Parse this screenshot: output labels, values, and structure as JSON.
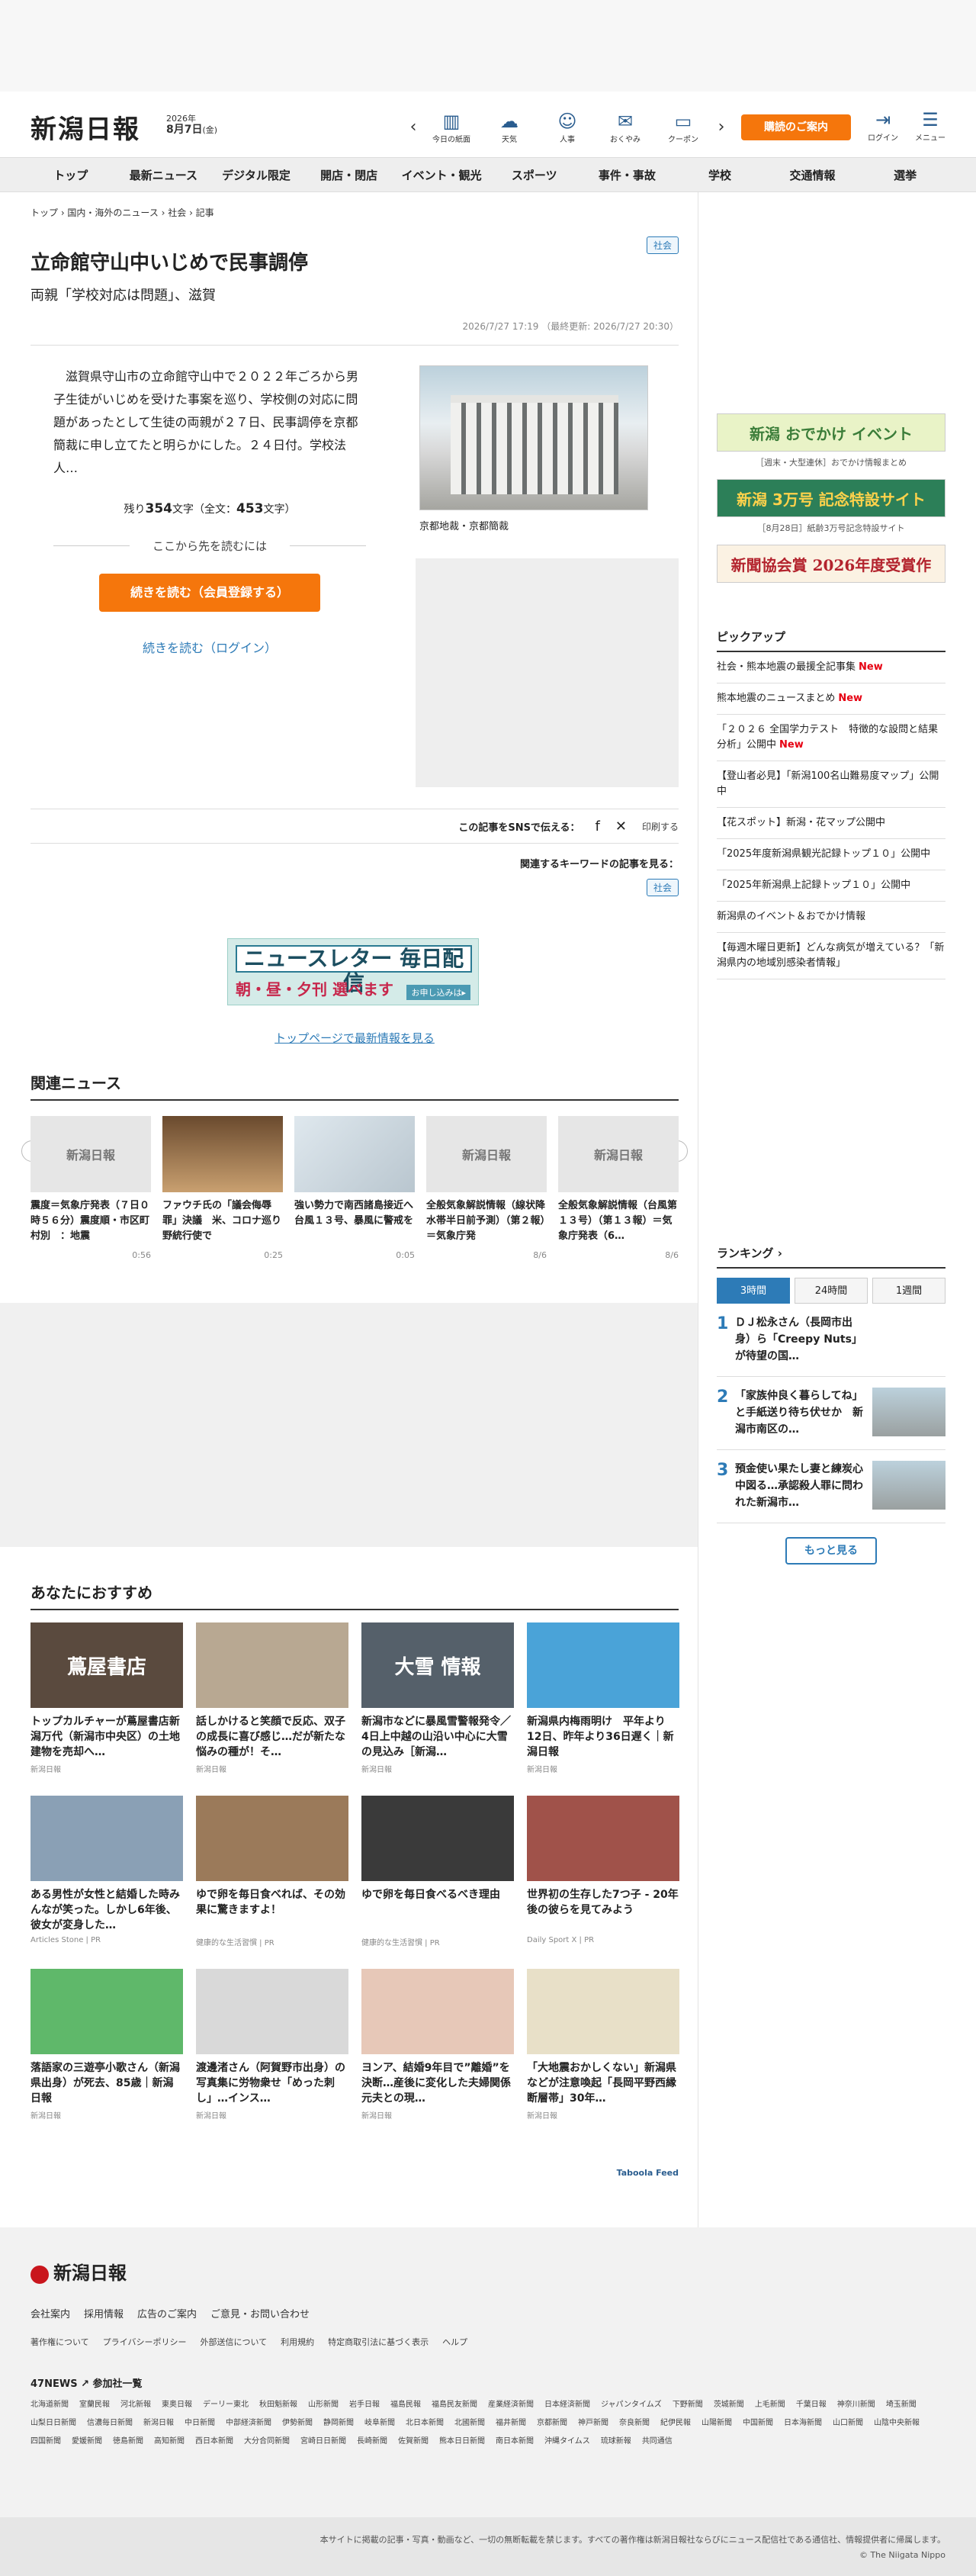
{
  "header": {
    "logo": "新潟日報",
    "date_year": "2026年",
    "date_md": "8月7日",
    "date_wd": "(金)",
    "icons": [
      {
        "label": "今日の紙面",
        "icon": "newspaper-icon",
        "glyph": "▥"
      },
      {
        "label": "天気",
        "icon": "weather-icon",
        "glyph": "☁"
      },
      {
        "label": "人事",
        "icon": "people-icon",
        "glyph": "☺"
      },
      {
        "label": "おくやみ",
        "icon": "condolence-icon",
        "glyph": "✉"
      },
      {
        "label": "クーポン",
        "icon": "coupon-icon",
        "glyph": "▭"
      }
    ],
    "subscribe": "購読のご案内",
    "login": "ログイン",
    "menu": "メニュー"
  },
  "nav": [
    "トップ",
    "最新ニュース",
    "デジタル限定",
    "開店・閉店",
    "イベント・観光",
    "スポーツ",
    "事件・事故",
    "学校",
    "交通情報",
    "選挙"
  ],
  "article": {
    "breadcrumb": "トップ › 国内・海外のニュース › 社会 › 記事",
    "tag": "社会",
    "title": "立命館守山中いじめで民事調停",
    "subtitle": "両親「学校対応は問題」、滋賀",
    "datetime": "2026/7/27 17:19 （最終更新: 2026/7/27 20:30）",
    "lead": "滋賀県守山市の立命館守山中で２０２２年ごろから男子生徒がいじめを受けた事案を巡り、学校側の対応に問題があったとして生徒の両親が２７日、民事調停を京都簡裁に申し立てたと明らかにした。２４日付。学校法人…",
    "remaining_pre": "残り",
    "remaining_num": "354",
    "remaining_mid": "文字（全文：",
    "total_num": "453",
    "remaining_post": "文字）",
    "continue_text": "ここから先を読むには",
    "register_btn": "続きを読む（会員登録する）",
    "login_link": "続きを読む（ログイン）",
    "photo_caption": "京都地裁・京都簡裁",
    "share_label": "この記事をSNSで伝える：",
    "print": "印刷する",
    "keyword_label": "関連するキーワードの記事を見る：",
    "keyword_tag": "社会",
    "newsletter_title": "ニュースレター 毎日配信",
    "newsletter_sub": "朝・昼・夕刊 選べます",
    "newsletter_btn": "お申し込みは▸",
    "top_link": "トップページで最新情報を見る"
  },
  "related": {
    "heading": "関連ニュース",
    "items": [
      {
        "text": "震度＝気象庁発表（７日０時５６分）震度順・市区町村別　：地震",
        "time": "0:56",
        "thumb": "新潟日報"
      },
      {
        "text": "ファウチ氏の「議会侮辱罪」決議　米、コロナ巡り野統行使で",
        "time": "0:25",
        "thumb": ""
      },
      {
        "text": "強い勢力で南西諸島接近へ　台風１３号、暴風に警戒を",
        "time": "0:05",
        "thumb": ""
      },
      {
        "text": "全般気象解説情報（線状降水帯半日前予測）（第２報）＝気象庁発",
        "time": "8/6",
        "thumb": "新潟日報"
      },
      {
        "text": "全般気象解説情報（台風第１３号）（第１３報）＝気象庁発表（6…",
        "time": "8/6",
        "thumb": "新潟日報"
      }
    ]
  },
  "recommend": {
    "heading": "あなたにおすすめ",
    "taboola": "Taboola Feed",
    "items": [
      {
        "text": "トップカルチャーが蔦屋書店新潟万代（新潟市中央区）の土地建物を売却へ…",
        "src": "新潟日報",
        "thumb": "蔦屋書店",
        "color": "#5a4a3e"
      },
      {
        "text": "話しかけると笑顔で反応、双子の成長に喜び感じ…だが新たな悩みの種が！そ…",
        "src": "新潟日報",
        "thumb": "",
        "color": "#b8a892"
      },
      {
        "text": "新潟市などに暴風雪警報発令／4日上中越の山沿い中心に大雪の見込み［新潟…",
        "src": "新潟日報",
        "thumb": "大雪 情報",
        "color": "#55606a"
      },
      {
        "text": "新潟県内梅雨明け　平年より12日、昨年より36日遅く｜新潟日報",
        "src": "新潟日報",
        "thumb": "",
        "color": "#4aa3d8"
      },
      {
        "text": "ある男性が女性と結婚した時みんなが笑った。しかし6年後、彼女が変身した…",
        "src": "Articles Stone | PR",
        "thumb": "",
        "color": "#8aa0b5"
      },
      {
        "text": "ゆで卵を毎日食べれば、その効果に驚きますよ！",
        "src": "健康的な生活習慣 | PR",
        "thumb": "",
        "color": "#9b7a5a"
      },
      {
        "text": "ゆで卵を毎日食べるべき理由",
        "src": "健康的な生活習慣 | PR",
        "thumb": "",
        "color": "#3a3a3a"
      },
      {
        "text": "世界初の生存した7つ子 - 20年後の彼らを見てみよう",
        "src": "Daily Sport X | PR",
        "thumb": "",
        "color": "#a0524a"
      },
      {
        "text": "落語家の三遊亭小歌さん（新潟県出身）が死去、85歳｜新潟日報",
        "src": "新潟日報",
        "thumb": "",
        "color": "#5fb86a"
      },
      {
        "text": "渡邊渚さん（阿賀野市出身）の写真集に労物衆せ「めった刺し」…インス…",
        "src": "新潟日報",
        "thumb": "",
        "color": "#d9d9d9"
      },
      {
        "text": "ヨンア、結婚9年目で”離婚”を決断…産後に変化した夫婦関係　元夫との現…",
        "src": "新潟日報",
        "thumb": "",
        "color": "#e7c8b8"
      },
      {
        "text": "「大地震おかしくない」新潟県などが注意喚起「長岡平野西縁断層帯」30年…",
        "src": "新潟日報",
        "thumb": "",
        "color": "#e8e0c8"
      }
    ]
  },
  "side": {
    "banners": [
      {
        "text": "新潟 おでかけ イベント",
        "caption": "［週末・大型連休］おでかけ情報まとめ"
      },
      {
        "text": "新潟 3万号 記念特設サイト",
        "caption": "［8月28日］紙齢3万号記念特設サイト"
      },
      {
        "text": "新聞協会賞 2026年度受賞作",
        "caption": ""
      }
    ],
    "pickup_heading": "ピックアップ",
    "pickup": [
      {
        "text": "社会・熊本地震の最援全記事集",
        "new": "New"
      },
      {
        "text": "熊本地震のニュースまとめ",
        "new": "New"
      },
      {
        "text": "「２０２６ 全国学力テスト　特徴的な設問と結果分析」公開中",
        "new": "New"
      },
      {
        "text": "【登山者必見】「新潟100名山難易度マップ」公開中",
        "new": ""
      },
      {
        "text": "【花スポット】新潟・花マップ公開中",
        "new": ""
      },
      {
        "text": "「2025年度新潟県観光記録トップ１０」公開中",
        "new": ""
      },
      {
        "text": "「2025年新潟県上記録トップ１０」公開中",
        "new": ""
      },
      {
        "text": "新潟県のイベント＆おでかけ情報",
        "new": ""
      },
      {
        "text": "【毎週木曜日更新】どんな病気が増えている？「新潟県内の地域別感染者情報」",
        "new": ""
      }
    ],
    "ranking_heading": "ランキング ›",
    "ranking_tabs": [
      "3時間",
      "24時間",
      "1週間"
    ],
    "ranking": [
      {
        "num": "1",
        "text": "ＤＪ松永さん（長岡市出身）ら「Creepy Nuts」が待望の国…"
      },
      {
        "num": "2",
        "text": "「家族仲良く暮らしてね」と手紙送り待ち伏せか　新潟市南区の…"
      },
      {
        "num": "3",
        "text": "預金使い果たし妻と練炭心中図る…承認殺人罪に問われた新潟市…"
      }
    ],
    "more": "もっと見る"
  },
  "footer": {
    "logo": "新潟日報",
    "row1": [
      "会社案内",
      "採用情報",
      "広告のご案内",
      "ご意見・お問い合わせ"
    ],
    "row2": [
      "著作権について",
      "プライバシーポリシー",
      "外部送信について",
      "利用規約",
      "特定商取引法に基づく表示",
      "ヘルプ"
    ],
    "news47": "47NEWS ↗ 参加社一覧",
    "papers": [
      "北海道新聞",
      "室蘭民報",
      "河北新報",
      "東奥日報",
      "デーリー東北",
      "秋田魁新報",
      "山形新聞",
      "岩手日報",
      "福島民報",
      "福島民友新聞",
      "産業経済新聞",
      "日本経済新聞",
      "ジャパンタイムズ",
      "下野新聞",
      "茨城新聞",
      "上毛新聞",
      "千葉日報",
      "神奈川新聞",
      "埼玉新聞",
      "山梨日日新聞",
      "信濃毎日新聞",
      "新潟日報",
      "中日新聞",
      "中部経済新聞",
      "伊勢新聞",
      "静岡新聞",
      "岐阜新聞",
      "北日本新聞",
      "北國新聞",
      "福井新聞",
      "京都新聞",
      "神戸新聞",
      "奈良新聞",
      "紀伊民報",
      "山陽新聞",
      "中国新聞",
      "日本海新聞",
      "山口新聞",
      "山陰中央新報",
      "四国新聞",
      "愛媛新聞",
      "徳島新聞",
      "高知新聞",
      "西日本新聞",
      "大分合同新聞",
      "宮崎日日新聞",
      "長崎新聞",
      "佐賀新聞",
      "熊本日日新聞",
      "南日本新聞",
      "沖縄タイムス",
      "琉球新報",
      "共同通信"
    ],
    "notice": "本サイトに掲載の記事・写真・動画など、一切の無断転載を禁じます。すべての著作権は新潟日報社ならびにニュース配信社である通信社、情報提供者に帰属します。",
    "copyright": "© The Niigata Nippo"
  }
}
